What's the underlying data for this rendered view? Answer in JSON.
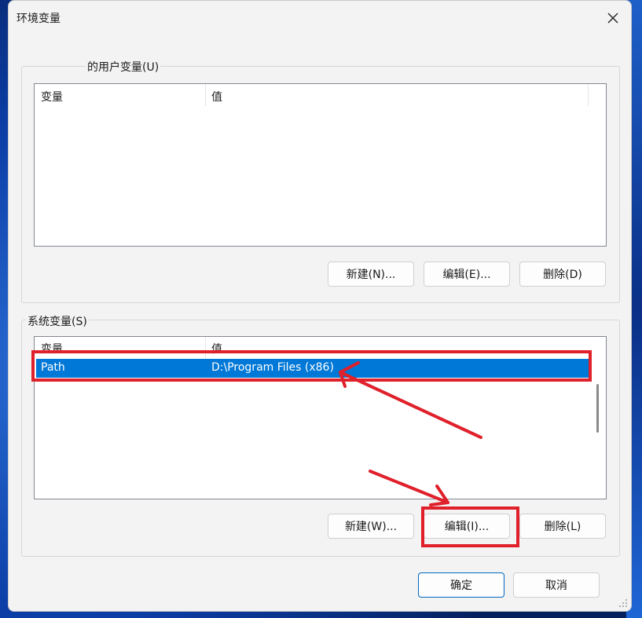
{
  "dialog": {
    "title": "环境变量",
    "close_icon": "close-icon"
  },
  "user_vars": {
    "group_label": "的用户变量(U)",
    "columns": [
      "变量",
      "值"
    ],
    "buttons": {
      "new": "新建(N)...",
      "edit": "编辑(E)...",
      "delete": "删除(D)"
    }
  },
  "system_vars": {
    "group_label": "系统变量(S)",
    "columns": [
      "变量",
      "值"
    ],
    "selected_row": {
      "name": "Path",
      "value": "D:\\Program Files (x86)"
    },
    "buttons": {
      "new": "新建(W)...",
      "edit": "编辑(I)...",
      "delete": "删除(L)"
    }
  },
  "footer": {
    "ok": "确定",
    "cancel": "取消"
  },
  "colors": {
    "selection": "#0078d7",
    "annotation": "#e0202a"
  }
}
